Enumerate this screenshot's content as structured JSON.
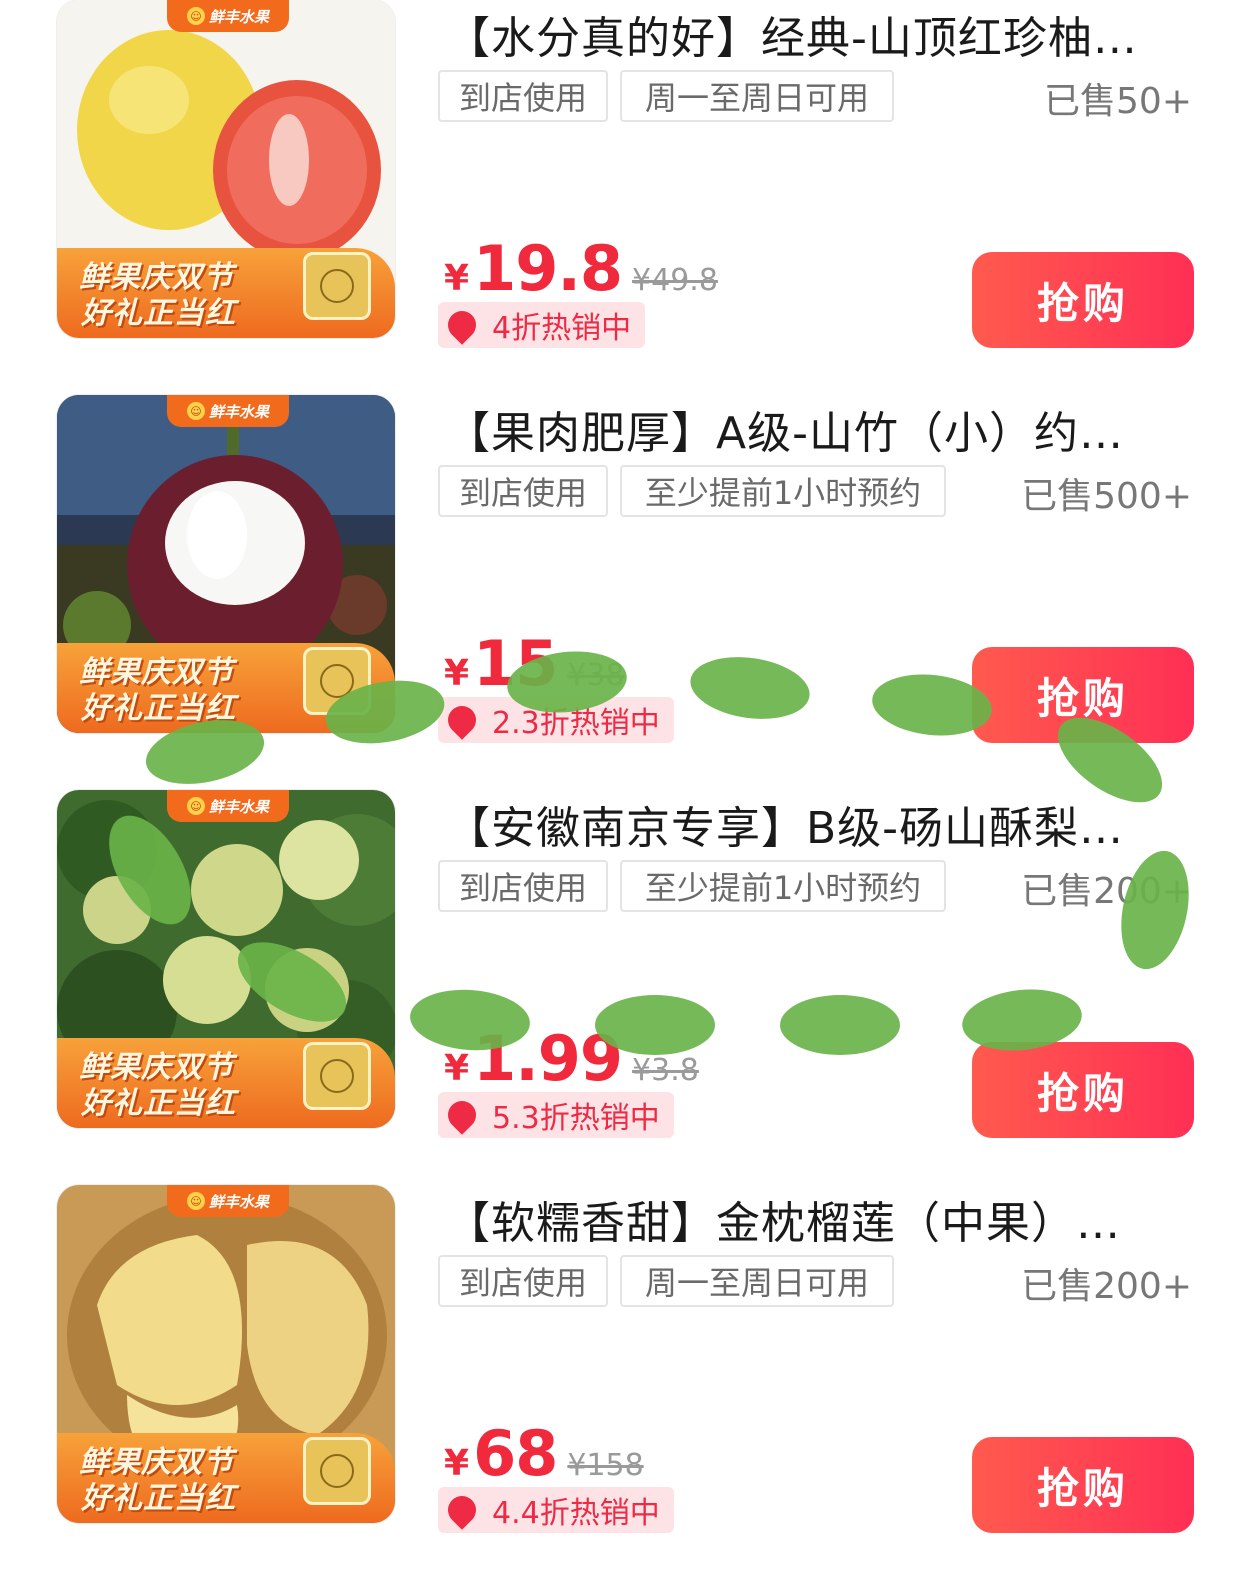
{
  "brand_tab": "鲜丰水果",
  "promo_banner": {
    "line1": "鲜果庆双节",
    "line2": "好礼正当红"
  },
  "buy_label": "抢购",
  "currency": "¥",
  "products": [
    {
      "title": "【水分真的好】经典-山顶红珍柚…",
      "tags": [
        "到店使用",
        "周一至周日可用"
      ],
      "sold": "已售50+",
      "price": "19.8",
      "original_price": "¥49.8",
      "discount": "4折热销中",
      "image": "pomelo"
    },
    {
      "title": "【果肉肥厚】A级-山竹（小）约…",
      "tags": [
        "到店使用",
        "至少提前1小时预约"
      ],
      "sold": "已售500+",
      "price": "15",
      "original_price": "¥38",
      "discount": "2.3折热销中",
      "image": "mangosteen"
    },
    {
      "title": "【安徽南京专享】B级-砀山酥梨…",
      "tags": [
        "到店使用",
        "至少提前1小时预约"
      ],
      "sold": "已售200+",
      "price": "1.99",
      "original_price": "¥3.8",
      "discount": "5.3折热销中",
      "image": "pear"
    },
    {
      "title": "【软糯香甜】金枕榴莲（中果）…",
      "tags": [
        "到店使用",
        "周一至周日可用"
      ],
      "sold": "已售200+",
      "price": "68",
      "original_price": "¥158",
      "discount": "4.4折热销中",
      "image": "durian"
    }
  ]
}
